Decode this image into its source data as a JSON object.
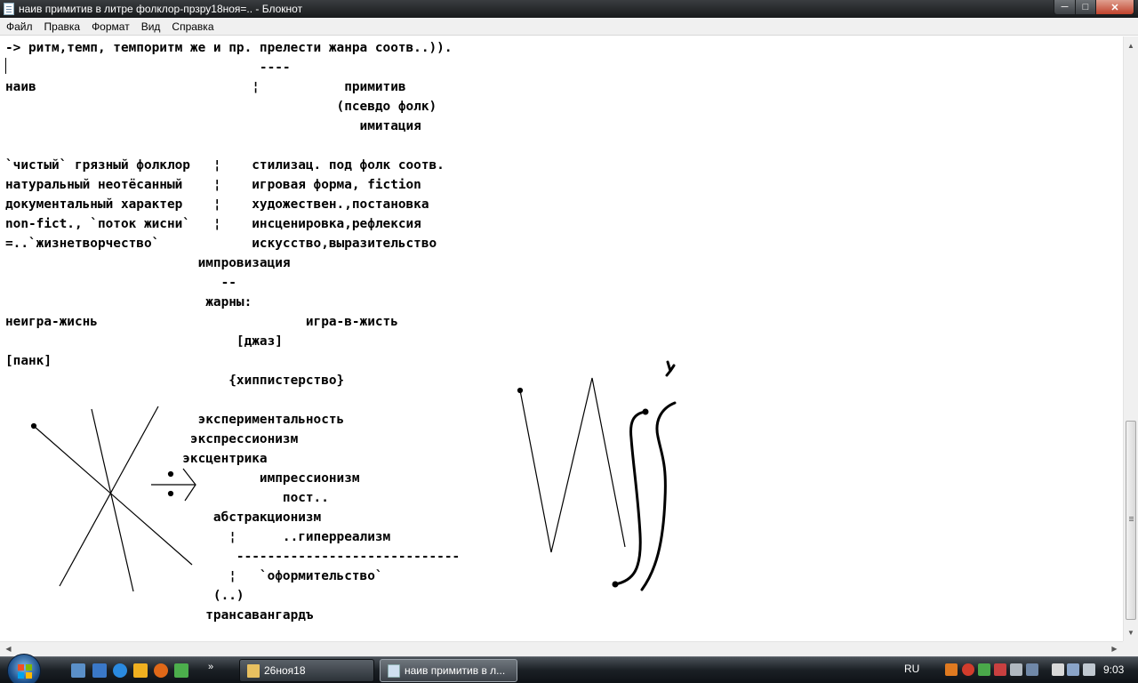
{
  "window": {
    "title": "наив примитив в литре фолклор-прзру18ноя=.. - Блокнот",
    "minimize_glyph": "─",
    "maximize_glyph": "□",
    "close_glyph": "✕"
  },
  "menu": [
    "Файл",
    "Правка",
    "Формат",
    "Вид",
    "Справка"
  ],
  "document": {
    "lines": [
      "-> ритм,темп, темпоритм же и пр. прелести жанра соотв..)).",
      "                                 ----",
      "наив                            ¦           примитив",
      "                                           (псевдо фолк)",
      "                                              имитация",
      "",
      "`чистый` грязный фолклор   ¦    стилизац. под фолк соотв.",
      "натуральный неотёсанный    ¦    игровая форма, fiction",
      "документальный характер    ¦    художествен.,постановка",
      "non-fict., `поток жисни`   ¦    инсценировка,рефлексия",
      "=..`жизнетворчество`            искусство,выразительство",
      "                         импровизация",
      "                            --",
      "                          жарны:",
      "неигра-жиснь                           игра-в-жисть",
      "                              [джаз]",
      "[панк]",
      "                             {хиппистерство}",
      "",
      "                         экспериментальность",
      "                        экспрессионизм",
      "                       эксцентрика",
      "                                 импрессионизм",
      "                                    пост..",
      "                           абстракционизм",
      "                             ¦      ..гиперреализм",
      "                              -----------------------------",
      "                             ¦   `оформительство`",
      "                           (..)",
      "                          трансавангардъ"
    ]
  },
  "taskbar": {
    "tasks": [
      {
        "label": "26ноя18",
        "icon": "folder-icon"
      },
      {
        "label": "наив примитив в л...",
        "icon": "notepad-icon"
      }
    ],
    "quick_launch_more": "»",
    "language": "RU",
    "clock": "9:03"
  },
  "colors": {
    "titlebar": "#17191b",
    "menubar": "#f0f0f0",
    "text": "#000000",
    "taskbar": "#1b2025",
    "close_button": "#c0422c"
  }
}
